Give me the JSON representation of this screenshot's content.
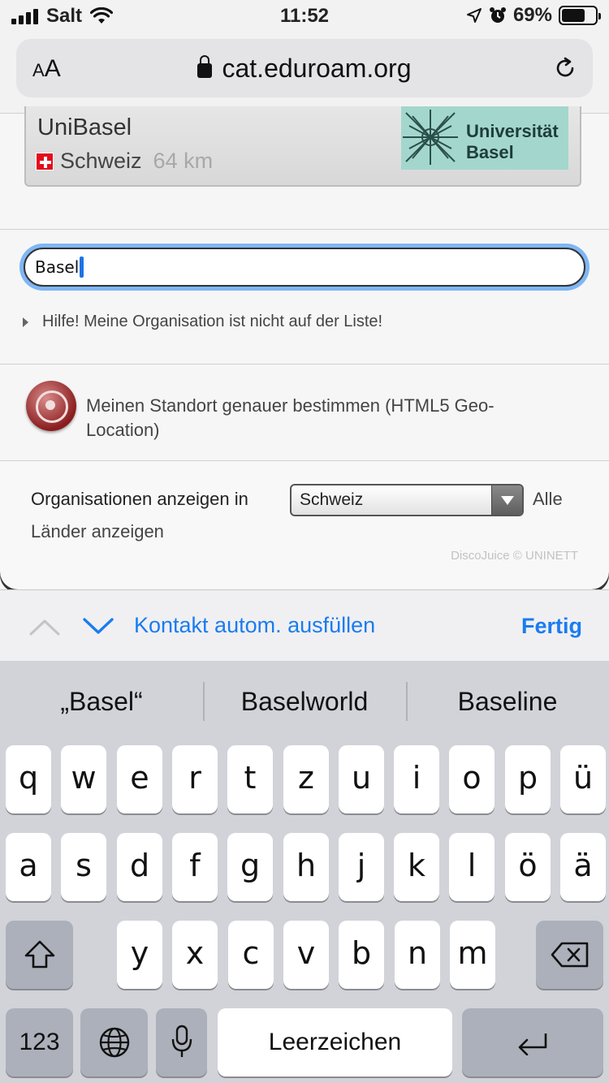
{
  "status_bar": {
    "carrier": "Salt",
    "time": "11:52",
    "battery": "69%",
    "battery_level": 0.69
  },
  "browser": {
    "text_size_label": "AA",
    "url": "cat.eduroam.org"
  },
  "org_card": {
    "name": "UniBasel",
    "country": "Schweiz",
    "distance": "64 km",
    "logo_text_1": "Universität",
    "logo_text_2": "Basel"
  },
  "search": {
    "value": "Basel"
  },
  "help_link": "Hilfe! Meine Organisation ist nicht auf der Liste!",
  "geo_location": {
    "text": "Meinen Standort genauer bestimmen (HTML5 Geo-Location)"
  },
  "filter": {
    "label": "Organisationen anzeigen in",
    "selected_country": "Schweiz",
    "all_countries_part1": "Alle",
    "all_countries_part2": "Länder anzeigen"
  },
  "credits": "DiscoJuice © UNINETT",
  "accessory": {
    "autofill": "Kontakt autom. ausfüllen",
    "done": "Fertig"
  },
  "keyboard": {
    "suggestions": [
      "„Basel“",
      "Baselworld",
      "Baseline"
    ],
    "row1": [
      "q",
      "w",
      "e",
      "r",
      "t",
      "z",
      "u",
      "i",
      "o",
      "p",
      "ü"
    ],
    "row2": [
      "a",
      "s",
      "d",
      "f",
      "g",
      "h",
      "j",
      "k",
      "l",
      "ö",
      "ä"
    ],
    "row3": [
      "y",
      "x",
      "c",
      "v",
      "b",
      "n",
      "m"
    ],
    "numbers_key": "123",
    "space_key": "Leerzeichen",
    "icons": [
      "shift-icon",
      "backspace-icon",
      "globe-icon",
      "microphone-icon",
      "return-icon"
    ]
  }
}
